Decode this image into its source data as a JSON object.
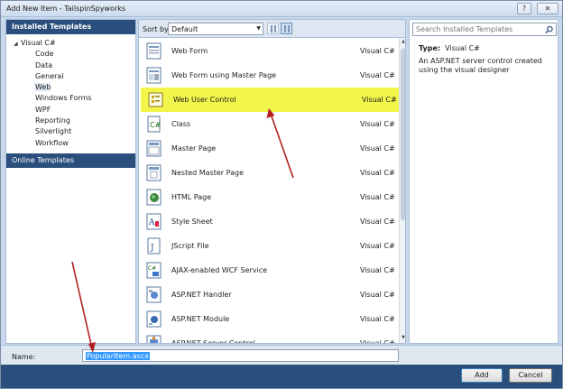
{
  "window": {
    "title": "Add New Item - TailspinSpyworks",
    "help_label": "?",
    "close_label": "✕"
  },
  "left": {
    "header": "Installed Templates",
    "root": "Visual C#",
    "children": [
      "Code",
      "Data",
      "General",
      "Web",
      "Windows Forms",
      "WPF",
      "Reporting",
      "Silverlight",
      "Workflow"
    ],
    "selected": "Web",
    "online": "Online Templates"
  },
  "toolbar": {
    "sortby_label": "Sort by:",
    "sortby_value": "Default"
  },
  "templates": [
    {
      "name": "Web Form",
      "lang": "Visual C#",
      "icon": "web-form-icon"
    },
    {
      "name": "Web Form using Master Page",
      "lang": "Visual C#",
      "icon": "web-form-master-icon"
    },
    {
      "name": "Web User Control",
      "lang": "Visual C#",
      "icon": "user-control-icon",
      "selected": true
    },
    {
      "name": "Class",
      "lang": "Visual C#",
      "icon": "class-file-icon"
    },
    {
      "name": "Master Page",
      "lang": "Visual C#",
      "icon": "master-page-icon"
    },
    {
      "name": "Nested Master Page",
      "lang": "Visual C#",
      "icon": "nested-master-page-icon"
    },
    {
      "name": "HTML Page",
      "lang": "Visual C#",
      "icon": "html-page-icon"
    },
    {
      "name": "Style Sheet",
      "lang": "Visual C#",
      "icon": "style-sheet-icon"
    },
    {
      "name": "JScript File",
      "lang": "Visual C#",
      "icon": "jscript-file-icon"
    },
    {
      "name": "AJAX-enabled WCF Service",
      "lang": "Visual C#",
      "icon": "wcf-service-icon"
    },
    {
      "name": "ASP.NET Handler",
      "lang": "Visual C#",
      "icon": "handler-icon"
    },
    {
      "name": "ASP.NET Module",
      "lang": "Visual C#",
      "icon": "module-icon"
    },
    {
      "name": "ASP.NET Server Control",
      "lang": "Visual C#",
      "icon": "server-control-icon"
    }
  ],
  "right": {
    "search_placeholder": "Search Installed Templates",
    "type_label": "Type:",
    "type_value": "Visual C#",
    "description": "An ASP.NET server control created using the visual designer"
  },
  "bottom": {
    "name_label": "Name:",
    "name_value": "PopularItem.ascx"
  },
  "buttons": {
    "add": "Add",
    "cancel": "Cancel"
  },
  "colors": {
    "header_blue": "#2b4f7c",
    "highlight_yellow": "#f2f54a",
    "annotation_red": "#b02020"
  }
}
